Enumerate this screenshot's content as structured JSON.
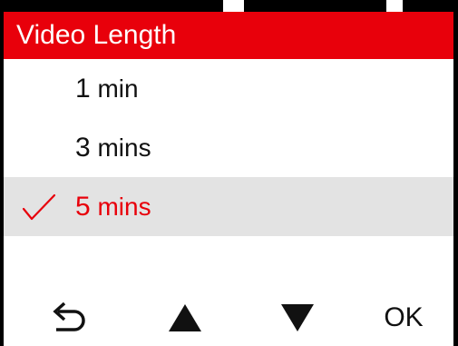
{
  "header": {
    "title": "Video Length"
  },
  "menu": {
    "items": [
      {
        "number": "1",
        "unit": " min",
        "selected": false
      },
      {
        "number": "3",
        "unit": " mins",
        "selected": false
      },
      {
        "number": "5",
        "unit": " mins",
        "selected": true
      }
    ]
  },
  "bottom_bar": {
    "back_icon": "back-arrow-icon",
    "up_icon": "up-triangle-icon",
    "down_icon": "down-triangle-icon",
    "ok_label": "OK"
  },
  "colors": {
    "accent": "#e8000b",
    "selected_bg": "#e3e3e3",
    "text": "#111111",
    "header_text": "#ffffff"
  }
}
